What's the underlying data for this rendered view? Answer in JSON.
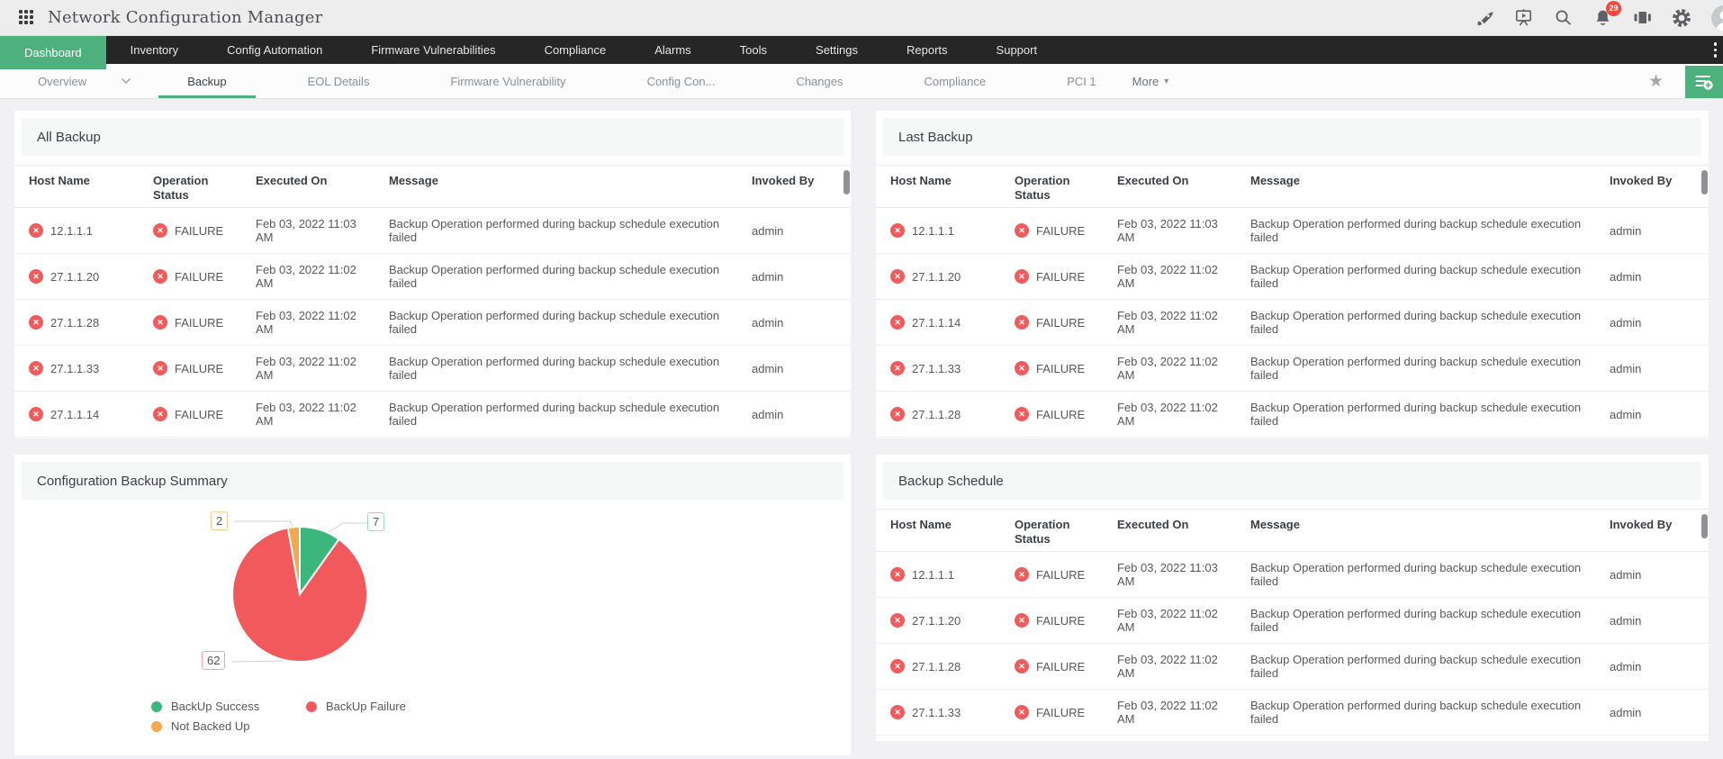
{
  "header": {
    "app_title": "Network Configuration Manager",
    "notification_count": "29",
    "icons": [
      "apps-grid",
      "rocket",
      "presentation-play",
      "search",
      "bell",
      "equalizer",
      "gear",
      "user-avatar"
    ]
  },
  "nav": {
    "items": [
      {
        "label": "Dashboard",
        "active": true
      },
      {
        "label": "Inventory"
      },
      {
        "label": "Config Automation"
      },
      {
        "label": "Firmware Vulnerabilities"
      },
      {
        "label": "Compliance"
      },
      {
        "label": "Alarms"
      },
      {
        "label": "Tools"
      },
      {
        "label": "Settings"
      },
      {
        "label": "Reports"
      },
      {
        "label": "Support"
      }
    ]
  },
  "subnav": {
    "tabs": [
      {
        "label": "Overview"
      },
      {
        "label": "Backup",
        "active": true
      },
      {
        "label": "EOL Details"
      },
      {
        "label": "Firmware Vulnerability"
      },
      {
        "label": "Config Con..."
      },
      {
        "label": "Changes"
      },
      {
        "label": "Compliance"
      },
      {
        "label": "PCI 1"
      },
      {
        "label": "More"
      }
    ],
    "icons": [
      "star",
      "add-dashboard"
    ]
  },
  "tables": {
    "columns": [
      {
        "key": "host",
        "label": "Host Name",
        "icon": true
      },
      {
        "key": "status",
        "label": "Operation Status",
        "icon": true
      },
      {
        "key": "executed",
        "label": "Executed On",
        "icon": false
      },
      {
        "key": "message",
        "label": "Message",
        "icon": false
      },
      {
        "key": "invoked",
        "label": "Invoked By",
        "icon": false
      }
    ]
  },
  "panels": {
    "all_backup": {
      "title": "All Backup",
      "rows": [
        {
          "host": "12.1.1.1",
          "status": "FAILURE",
          "executed": "Feb 03, 2022 11:03 AM",
          "message": "Backup Operation performed during backup schedule execution failed",
          "invoked": "admin"
        },
        {
          "host": "27.1.1.20",
          "status": "FAILURE",
          "executed": "Feb 03, 2022 11:02 AM",
          "message": "Backup Operation performed during backup schedule execution failed",
          "invoked": "admin"
        },
        {
          "host": "27.1.1.28",
          "status": "FAILURE",
          "executed": "Feb 03, 2022 11:02 AM",
          "message": "Backup Operation performed during backup schedule execution failed",
          "invoked": "admin"
        },
        {
          "host": "27.1.1.33",
          "status": "FAILURE",
          "executed": "Feb 03, 2022 11:02 AM",
          "message": "Backup Operation performed during backup schedule execution failed",
          "invoked": "admin"
        },
        {
          "host": "27.1.1.14",
          "status": "FAILURE",
          "executed": "Feb 03, 2022 11:02 AM",
          "message": "Backup Operation performed during backup schedule execution failed",
          "invoked": "admin"
        }
      ]
    },
    "last_backup": {
      "title": "Last Backup",
      "rows": [
        {
          "host": "12.1.1.1",
          "status": "FAILURE",
          "executed": "Feb 03, 2022 11:03 AM",
          "message": "Backup Operation performed during backup schedule execution failed",
          "invoked": "admin"
        },
        {
          "host": "27.1.1.20",
          "status": "FAILURE",
          "executed": "Feb 03, 2022 11:02 AM",
          "message": "Backup Operation performed during backup schedule execution failed",
          "invoked": "admin"
        },
        {
          "host": "27.1.1.14",
          "status": "FAILURE",
          "executed": "Feb 03, 2022 11:02 AM",
          "message": "Backup Operation performed during backup schedule execution failed",
          "invoked": "admin"
        },
        {
          "host": "27.1.1.33",
          "status": "FAILURE",
          "executed": "Feb 03, 2022 11:02 AM",
          "message": "Backup Operation performed during backup schedule execution failed",
          "invoked": "admin"
        },
        {
          "host": "27.1.1.28",
          "status": "FAILURE",
          "executed": "Feb 03, 2022 11:02 AM",
          "message": "Backup Operation performed during backup schedule execution failed",
          "invoked": "admin"
        }
      ]
    },
    "summary": {
      "title": "Configuration Backup Summary"
    },
    "backup_schedule": {
      "title": "Backup Schedule",
      "rows": [
        {
          "host": "12.1.1.1",
          "status": "FAILURE",
          "executed": "Feb 03, 2022 11:03 AM",
          "message": "Backup Operation performed during backup schedule execution failed",
          "invoked": "admin"
        },
        {
          "host": "27.1.1.20",
          "status": "FAILURE",
          "executed": "Feb 03, 2022 11:02 AM",
          "message": "Backup Operation performed during backup schedule execution failed",
          "invoked": "admin"
        },
        {
          "host": "27.1.1.28",
          "status": "FAILURE",
          "executed": "Feb 03, 2022 11:02 AM",
          "message": "Backup Operation performed during backup schedule execution failed",
          "invoked": "admin"
        },
        {
          "host": "27.1.1.33",
          "status": "FAILURE",
          "executed": "Feb 03, 2022 11:02 AM",
          "message": "Backup Operation performed during backup schedule execution failed",
          "invoked": "admin"
        }
      ]
    }
  },
  "chart_data": {
    "type": "pie",
    "title": "Configuration Backup Summary",
    "labels": [
      "BackUp Success",
      "BackUp Failure",
      "Not Backed Up"
    ],
    "values": [
      7,
      62,
      2
    ],
    "total": 71,
    "colors": [
      "#3bb77e",
      "#f1595c",
      "#f6a84c"
    ],
    "callout_border_colors": [
      "#9ed9b9",
      "#f7a3a4",
      "#f9cb90"
    ],
    "legend_position": "bottom",
    "start_angle_deg": 0,
    "direction": "clockwise"
  },
  "status_colors": {
    "failure": "#f25b5c",
    "accent_green": "#4cb17c"
  }
}
